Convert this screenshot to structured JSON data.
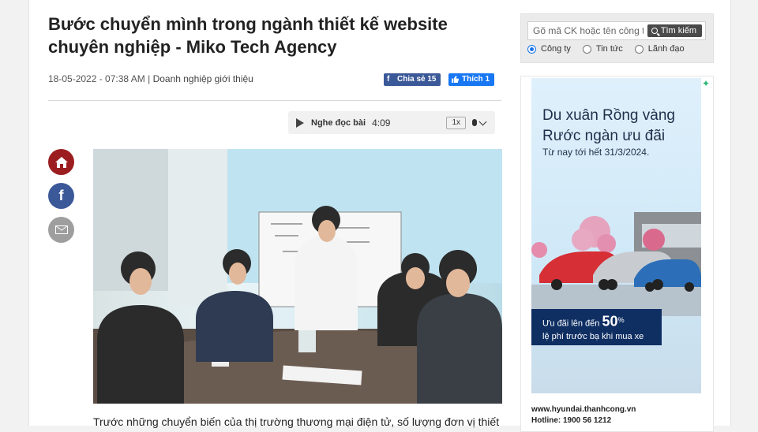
{
  "article": {
    "title": "Bước chuyển mình trong ngành thiết kế website chuyên nghiệp - Miko Tech Agency",
    "datetime": "18-05-2022 - 07:38 AM",
    "separator": "|",
    "category": "Doanh nghiệp giới thiệu",
    "share_label": "Chia sẻ 15",
    "like_label": "Thích 1",
    "lead": "Trước những chuyển biến của thị trường thương mại điện tử, số lượng đơn vị thiết"
  },
  "audio": {
    "label": "Nghe đọc bài",
    "duration": "4:09",
    "speed": "1x"
  },
  "social": [
    {
      "name": "home-icon"
    },
    {
      "name": "facebook-icon"
    },
    {
      "name": "mail-icon"
    }
  ],
  "search": {
    "placeholder": "Gõ mã CK hoặc tên công ty",
    "button": "Tìm kiếm",
    "options": [
      "Công ty",
      "Tin tức",
      "Lãnh đạo"
    ],
    "selected": 0
  },
  "ad": {
    "headline_1": "Du xuân Rồng vàng",
    "headline_2": "Rước ngàn ưu đãi",
    "subline": "Từ nay tới hết 31/3/2024.",
    "deal_prefix": "Ưu đãi lên đến",
    "deal_value": "50",
    "deal_unit": "%",
    "deal_suffix": "lệ phí trước bạ khi mua xe",
    "website": "www.hyundai.thanhcong.vn",
    "hotline": "Hotline: 1900 56 1212"
  },
  "colors": {
    "facebook": "#3b5998",
    "home": "#9b1d20",
    "ad_navy": "#0f2f63"
  }
}
